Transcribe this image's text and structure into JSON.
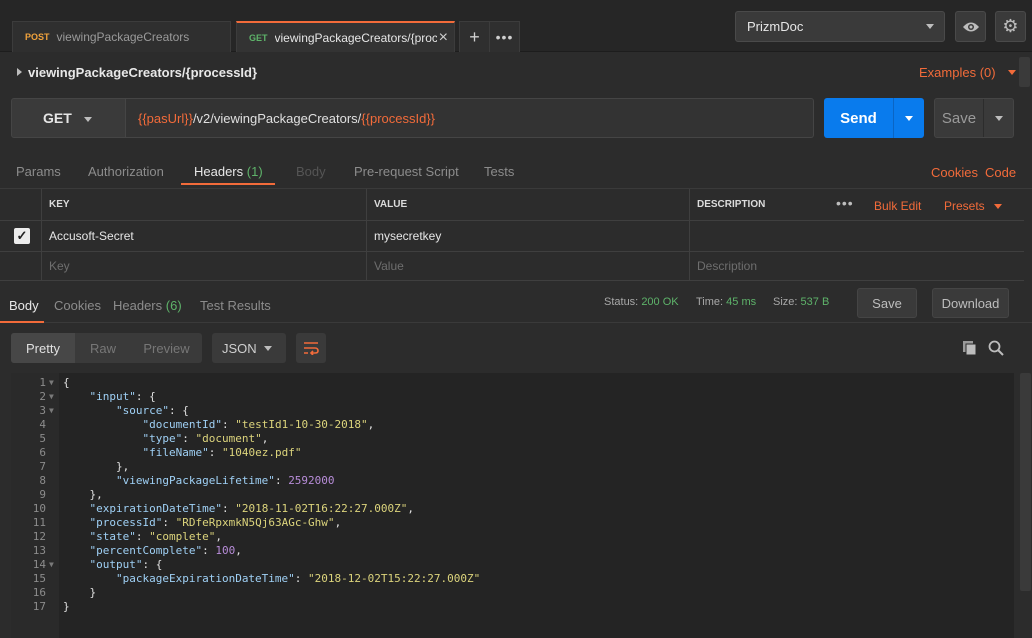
{
  "tabs": [
    {
      "method": "POST",
      "name": "viewingPackageCreators"
    },
    {
      "method": "GET",
      "name": "viewingPackageCreators/{proce"
    }
  ],
  "environment": {
    "selected": "PrizmDoc"
  },
  "breadcrumb": {
    "title": "viewingPackageCreators/{processId}"
  },
  "examples": {
    "label": "Examples (0)"
  },
  "request": {
    "method": "GET",
    "url_var1": "{{pasUrl}}",
    "url_mid": "/v2/viewingPackageCreators/",
    "url_var2": "{{processId}}",
    "send_label": "Send",
    "save_label": "Save"
  },
  "request_tabs": {
    "params": "Params",
    "authorization": "Authorization",
    "headers": "Headers",
    "headers_count": "(1)",
    "body": "Body",
    "prerequest": "Pre-request Script",
    "tests": "Tests",
    "cookies": "Cookies",
    "code": "Code"
  },
  "headers_table": {
    "columns": {
      "key": "KEY",
      "value": "VALUE",
      "description": "DESCRIPTION"
    },
    "bulk_edit": "Bulk Edit",
    "presets": "Presets",
    "rows": [
      {
        "key": "Accusoft-Secret",
        "value": "mysecretkey",
        "description": "",
        "checked": true
      }
    ],
    "placeholders": {
      "key": "Key",
      "value": "Value",
      "description": "Description"
    }
  },
  "response": {
    "tabs": {
      "body": "Body",
      "cookies": "Cookies",
      "headers": "Headers",
      "headers_count": "(6)",
      "test_results": "Test Results"
    },
    "status_label": "Status:",
    "status_value": "200 OK",
    "time_label": "Time:",
    "time_value": "45 ms",
    "size_label": "Size:",
    "size_value": "537 B",
    "save_label": "Save",
    "download_label": "Download"
  },
  "view": {
    "pretty": "Pretty",
    "raw": "Raw",
    "preview": "Preview",
    "format": "JSON"
  },
  "code_lines": [
    {
      "n": "1",
      "fold": true,
      "html": "{"
    },
    {
      "n": "2",
      "fold": true,
      "html": "    <span class=\"k\">\"input\"</span>: {"
    },
    {
      "n": "3",
      "fold": true,
      "html": "        <span class=\"k\">\"source\"</span>: {"
    },
    {
      "n": "4",
      "fold": false,
      "html": "            <span class=\"k\">\"documentId\"</span>: <span class=\"s\">\"testId1-10-30-2018\"</span>,"
    },
    {
      "n": "5",
      "fold": false,
      "html": "            <span class=\"k\">\"type\"</span>: <span class=\"s\">\"document\"</span>,"
    },
    {
      "n": "6",
      "fold": false,
      "html": "            <span class=\"k\">\"fileName\"</span>: <span class=\"s\">\"1040ez.pdf\"</span>"
    },
    {
      "n": "7",
      "fold": false,
      "html": "        },"
    },
    {
      "n": "8",
      "fold": false,
      "html": "        <span class=\"k\">\"viewingPackageLifetime\"</span>: <span class=\"n\">2592000</span>"
    },
    {
      "n": "9",
      "fold": false,
      "html": "    },"
    },
    {
      "n": "10",
      "fold": false,
      "html": "    <span class=\"k\">\"expirationDateTime\"</span>: <span class=\"s\">\"2018-11-02T16:22:27.000Z\"</span>,"
    },
    {
      "n": "11",
      "fold": false,
      "html": "    <span class=\"k\">\"processId\"</span>: <span class=\"s\">\"RDfeRpxmkN5Qj63AGc-Ghw\"</span>,"
    },
    {
      "n": "12",
      "fold": false,
      "html": "    <span class=\"k\">\"state\"</span>: <span class=\"s\">\"complete\"</span>,"
    },
    {
      "n": "13",
      "fold": false,
      "html": "    <span class=\"k\">\"percentComplete\"</span>: <span class=\"n\">100</span>,"
    },
    {
      "n": "14",
      "fold": true,
      "html": "    <span class=\"k\">\"output\"</span>: {"
    },
    {
      "n": "15",
      "fold": false,
      "html": "        <span class=\"k\">\"packageExpirationDateTime\"</span>: <span class=\"s\">\"2018-12-02T15:22:27.000Z\"</span>"
    },
    {
      "n": "16",
      "fold": false,
      "html": "    }"
    },
    {
      "n": "17",
      "fold": false,
      "html": "}"
    }
  ],
  "colors": {
    "accent": "#f26b3a",
    "send": "#097bed",
    "success": "#5eb36a"
  }
}
